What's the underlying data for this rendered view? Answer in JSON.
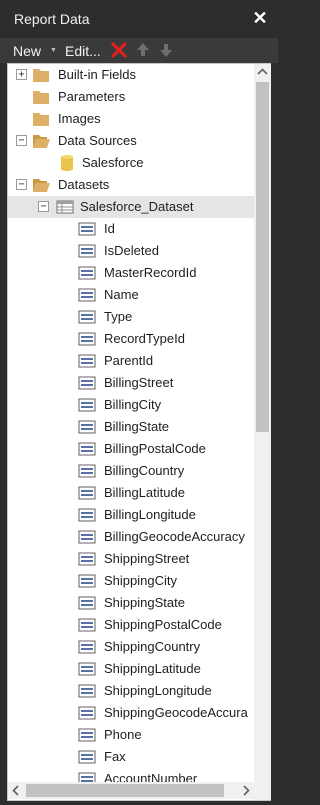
{
  "window": {
    "title": "Report Data",
    "close_label": "✕"
  },
  "toolbar": {
    "new_label": "New",
    "new_arrow": "▼",
    "edit_label": "Edit...",
    "delete_icon": "delete-icon",
    "up_icon": "move-up-icon",
    "down_icon": "move-down-icon"
  },
  "tree": {
    "builtin": "Built-in Fields",
    "parameters": "Parameters",
    "images": "Images",
    "datasources": "Data Sources",
    "salesforce": "Salesforce",
    "datasets": "Datasets",
    "dataset": "Salesforce_Dataset",
    "fields": [
      "Id",
      "IsDeleted",
      "MasterRecordId",
      "Name",
      "Type",
      "RecordTypeId",
      "ParentId",
      "BillingStreet",
      "BillingCity",
      "BillingState",
      "BillingPostalCode",
      "BillingCountry",
      "BillingLatitude",
      "BillingLongitude",
      "BillingGeocodeAccuracy",
      "ShippingStreet",
      "ShippingCity",
      "ShippingState",
      "ShippingPostalCode",
      "ShippingCountry",
      "ShippingLatitude",
      "ShippingLongitude",
      "ShippingGeocodeAccura",
      "Phone",
      "Fax",
      "AccountNumber"
    ],
    "expand_plus": "+",
    "expand_minus": "−"
  },
  "colors": {
    "folder": "#dcb067",
    "database": "#e8c44a",
    "accent_delete": "#e02020"
  }
}
